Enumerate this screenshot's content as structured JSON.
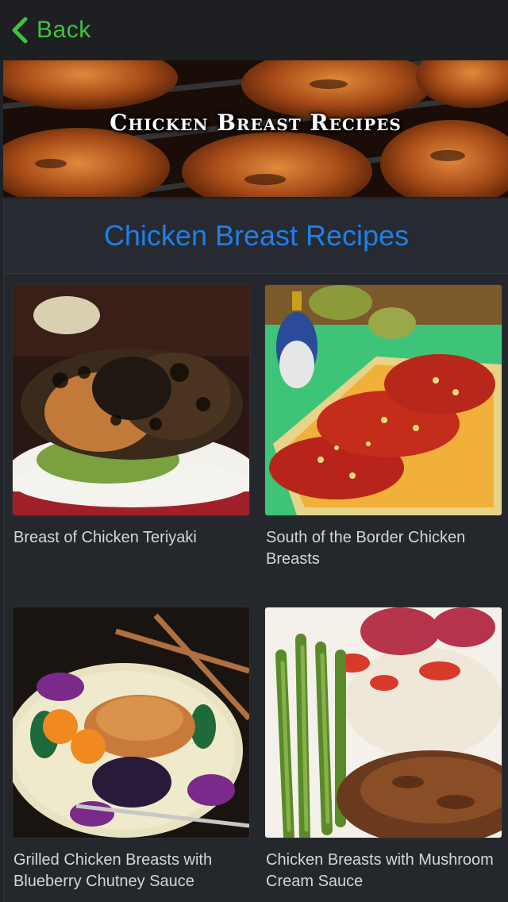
{
  "nav": {
    "back_label": "Back"
  },
  "banner": {
    "title": "Chicken Breast Recipes"
  },
  "page": {
    "heading": "Chicken Breast Recipes"
  },
  "recipes": [
    {
      "title": "Breast of Chicken Teriyaki"
    },
    {
      "title": "South of the Border Chicken Breasts"
    },
    {
      "title": "Grilled Chicken Breasts with Blueberry Chutney Sauce"
    },
    {
      "title": "Chicken Breasts with Mushroom Cream Sauce"
    }
  ],
  "colors": {
    "accent_green": "#3fc23f",
    "heading_blue": "#1f7fe8",
    "background": "#1f2227"
  }
}
